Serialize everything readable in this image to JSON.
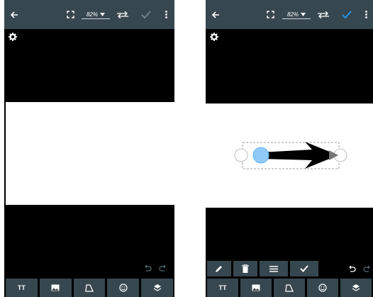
{
  "left_screen": {
    "toolbar": {
      "zoom": "82%",
      "icons": [
        "back-arrow-icon",
        "fullscreen-icon",
        "dropdown-icon",
        "swap-icon",
        "check-icon",
        "more-vert-icon"
      ],
      "check_color": "#78909c"
    },
    "canvas_color": "#ffffff",
    "bottom_bar": {
      "text_button_label": "TT",
      "icons": [
        "text-icon",
        "image-icon",
        "shape-icon",
        "emoji-icon",
        "layers-icon"
      ]
    }
  },
  "right_screen": {
    "toolbar": {
      "zoom": "82%",
      "icons": [
        "back-arrow-icon",
        "fullscreen-icon",
        "dropdown-icon",
        "swap-icon",
        "check-icon",
        "more-vert-icon"
      ],
      "check_color": "#2196f3"
    },
    "canvas_color": "#ffffff",
    "arrow": {
      "color": "#000000",
      "start_handle_color": "#90caf9",
      "end_handle_color": "#9e9e9e",
      "selection_border": "dashed"
    },
    "edit_bar": {
      "icons": [
        "pencil-icon",
        "trash-icon",
        "menu-lines-icon",
        "check-icon"
      ]
    },
    "bottom_bar": {
      "text_button_label": "TT",
      "icons": [
        "text-icon",
        "image-icon",
        "shape-icon",
        "emoji-icon",
        "layers-icon"
      ]
    }
  }
}
